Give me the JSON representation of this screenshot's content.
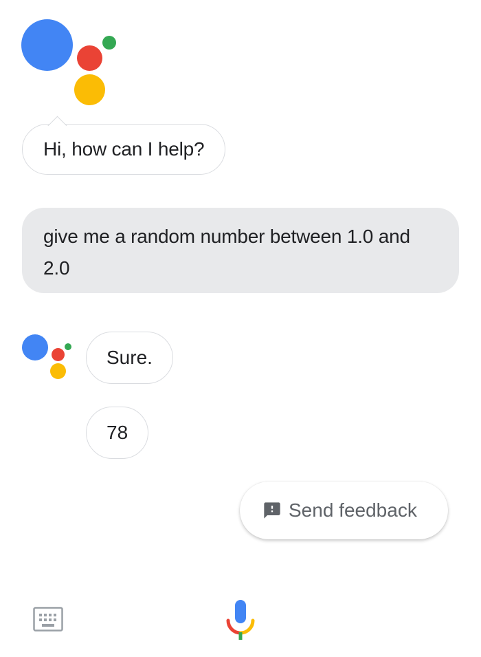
{
  "assistant": {
    "greeting": "Hi, how can I help?",
    "logo_colors": {
      "blue": "#4285f4",
      "red": "#ea4335",
      "yellow": "#fbbc05",
      "green": "#34a853"
    }
  },
  "conversation": {
    "user_query": "give me a random number between 1.0 and 2.0",
    "replies": [
      "Sure.",
      "78"
    ]
  },
  "feedback": {
    "label": "Send feedback",
    "icon": "feedback-icon"
  },
  "bottom_bar": {
    "keyboard_icon": "keyboard-icon",
    "mic_icon": "mic-icon"
  }
}
